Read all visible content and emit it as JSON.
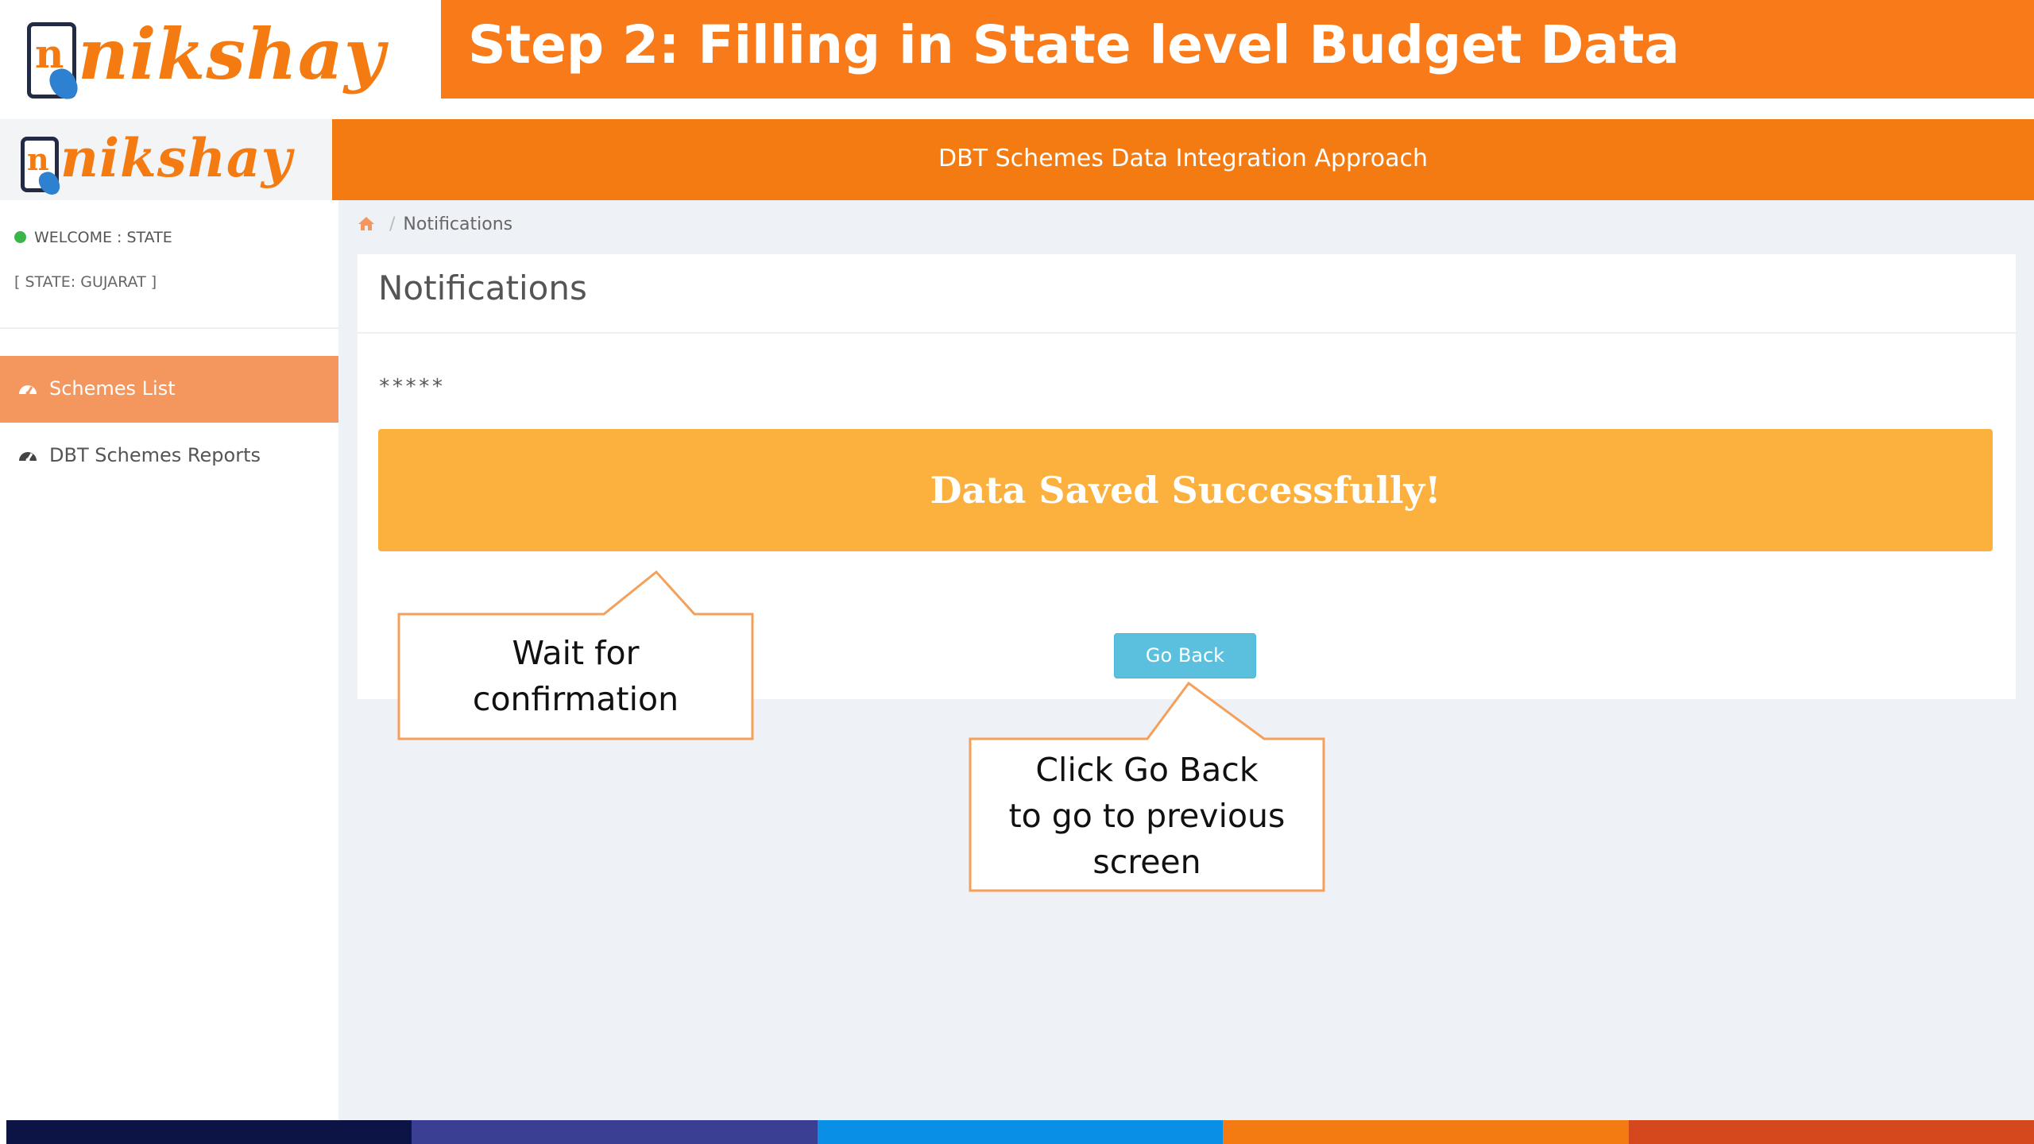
{
  "slide": {
    "title": "Step 2: Filling in State level Budget Data",
    "logo_text": "nikshay"
  },
  "app": {
    "logo_text": "nikshay",
    "header_title": "DBT Schemes Data Integration Approach"
  },
  "sidebar": {
    "welcome": "WELCOME : STATE",
    "state": "[ STATE: GUJARAT ]",
    "items": [
      {
        "label": "Schemes List",
        "icon": "dashboard-icon",
        "active": true
      },
      {
        "label": "DBT Schemes Reports",
        "icon": "dashboard-icon",
        "active": false
      }
    ]
  },
  "breadcrumb": {
    "home_icon": "home-icon",
    "current": "Notifications"
  },
  "panel": {
    "title": "Notifications",
    "masked_text": "*****",
    "success_message": "Data Saved Successfully!",
    "go_back_label": "Go Back"
  },
  "callouts": {
    "wait": [
      "Wait for",
      "confirmation"
    ],
    "go_back": [
      "Click Go Back",
      "to go to previous",
      "screen"
    ]
  },
  "colors": {
    "brand_orange": "#f47b12",
    "title_orange": "#f97a19",
    "active_menu": "#f4975e",
    "success_banner": "#fcb03e",
    "button_info": "#5bc0de",
    "callout_border": "#f5a05a",
    "bottom_strip": [
      "#0c1445",
      "#3a3f93",
      "#0a8fe6",
      "#f47b12",
      "#d5481d"
    ]
  }
}
